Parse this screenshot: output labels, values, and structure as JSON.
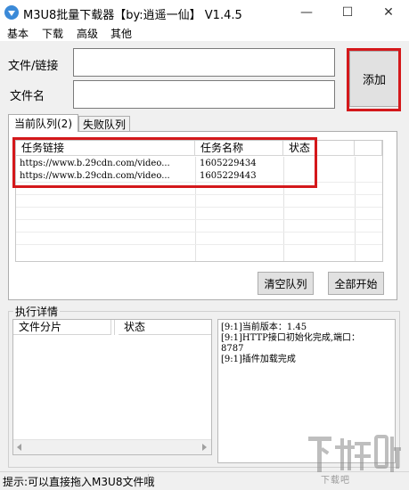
{
  "window": {
    "title": "M3U8批量下载器【by:逍遥一仙】 V1.4.5",
    "minimize_icon": "minimize-icon",
    "maximize_icon": "maximize-icon",
    "close_icon": "close-icon"
  },
  "menu": [
    "基本",
    "下载",
    "高级",
    "其他"
  ],
  "form": {
    "file_link_label": "文件/链接",
    "file_link_value": "",
    "filename_label": "文件名",
    "filename_value": "",
    "add_button": "添加"
  },
  "tabs": {
    "current": "当前队列(2)",
    "failed": "失败队列"
  },
  "queue": {
    "columns": [
      "任务链接",
      "任务名称",
      "状态"
    ],
    "rows": [
      {
        "link": "https://www.b.29cdn.com/video...",
        "name": "1605229434",
        "status": ""
      },
      {
        "link": "https://www.b.29cdn.com/video...",
        "name": "1605229443",
        "status": ""
      }
    ]
  },
  "buttons": {
    "clear_queue": "清空队列",
    "start_all": "全部开始"
  },
  "details": {
    "group_title": "执行详情",
    "columns": [
      "文件分片",
      "状态"
    ],
    "log": [
      "[9:1]当前版本：1.45",
      "[9:1]HTTP接口初始化完成,端口：",
      "8787",
      "[9:1]插件加载完成"
    ]
  },
  "status": {
    "hint": "提示:可以直接拖入M3U8文件哦"
  },
  "watermark": "下载吧",
  "colors": {
    "highlight": "#d4181b",
    "accent": "#3b8ad8"
  }
}
